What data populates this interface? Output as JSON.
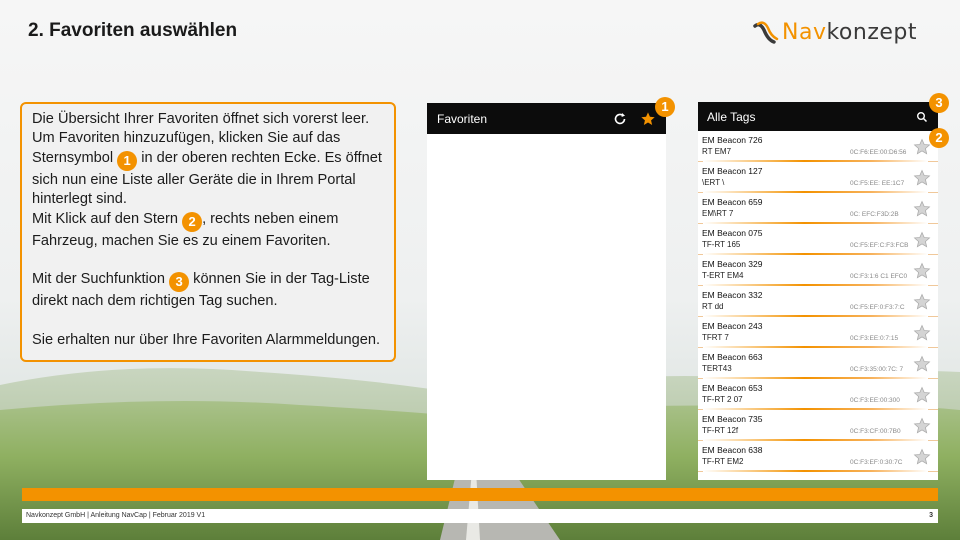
{
  "slide": {
    "title": "2. Favoriten auswählen"
  },
  "logo": {
    "text_part1": "Nav",
    "text_part2": "konzept"
  },
  "textbox": {
    "p1_a": "Die Übersicht Ihrer Favoriten öffnet sich vorerst leer. Um Favoriten hinzuzufügen, klicken Sie auf das Sternsymbol ",
    "p1_b": " in der oberen rechten Ecke. Es öffnet sich nun eine Liste aller Geräte die in Ihrem Portal hinterlegt sind.",
    "p2_a": "Mit Klick auf den Stern ",
    "p2_b": ", rechts neben einem Fahrzeug, machen Sie es zu einem Favoriten.",
    "p3_a": "Mit der Suchfunktion ",
    "p3_b": " können Sie in der Tag-Liste direkt nach dem richtigen Tag suchen.",
    "p4": "Sie erhalten nur über Ihre Favoriten Alarmmeldungen.",
    "badge1": "1",
    "badge2": "2",
    "badge3": "3"
  },
  "phone1": {
    "title": "Favoriten",
    "refresh_icon": "refresh-icon",
    "star_icon": "star-icon"
  },
  "phone2": {
    "title": "Alle Tags",
    "search_icon": "search-icon",
    "tags": [
      {
        "name": "EM Beacon 726",
        "sub": "RT  EM7",
        "mac": "0C:F6:EE:00:D6:56"
      },
      {
        "name": "EM Beacon 127",
        "sub": "\\ERT  \\",
        "mac": "0C:F5:EE:  EE:1C7"
      },
      {
        "name": "EM Beacon 659",
        "sub": "EM\\RT  7",
        "mac": "0C:  EFC:F3D:2B"
      },
      {
        "name": "EM Beacon 075",
        "sub": "TF-RT 165",
        "mac": "0C:F5:EF:C:F3:FCB"
      },
      {
        "name": "EM Beacon 329",
        "sub": "T-ERT  EM4",
        "mac": "0C:F3:1:6 C1 EFC0"
      },
      {
        "name": "EM Beacon 332",
        "sub": "RT  dd",
        "mac": "0C:F5:EF:0:F3:7:C"
      },
      {
        "name": "EM Beacon 243",
        "sub": "TFRT 7",
        "mac": "0C:F3:EE:0:7:15"
      },
      {
        "name": "EM Beacon 663",
        "sub": "TERT43",
        "mac": "0C:F3:35:00:7C:  7"
      },
      {
        "name": "EM Beacon 653",
        "sub": "TF-RT 2  07",
        "mac": "0C:F3:EE:00:300"
      },
      {
        "name": "EM Beacon 735",
        "sub": "TF-RT 12f",
        "mac": "0C:F3:CF:00:7B0"
      },
      {
        "name": "EM Beacon 638",
        "sub": "TF-RT EM2",
        "mac": "0C:F3:EF:0:30:7C"
      }
    ]
  },
  "callouts": {
    "c1": "1",
    "c2": "2",
    "c3": "3"
  },
  "footer": {
    "text": "Navkonzept GmbH  |  Anleitung NavCap  | Februar 2019 V1",
    "page": "3"
  },
  "colors": {
    "accent": "#f39200",
    "appbar": "#0c0c0c"
  }
}
